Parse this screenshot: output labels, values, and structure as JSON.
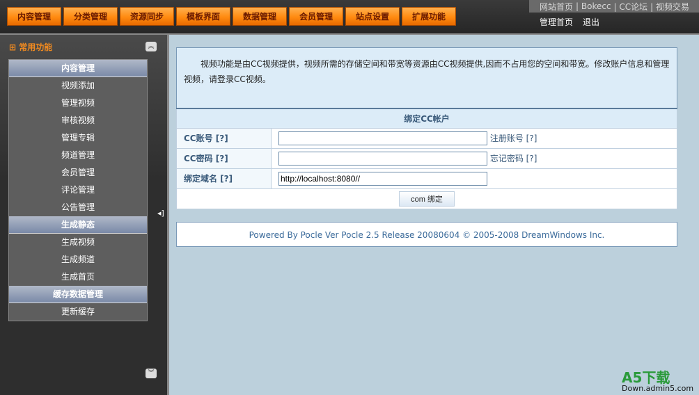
{
  "top_tabs": [
    "内容管理",
    "分类管理",
    "资源同步",
    "模板界面",
    "数据管理",
    "会员管理",
    "站点设置",
    "扩展功能"
  ],
  "top_links": [
    "网站首页",
    "| Bokecc",
    "| CC论坛",
    "| 视频交易"
  ],
  "user_links": [
    "管理首页",
    "退出"
  ],
  "sidebar": {
    "title": "常用功能",
    "groups": [
      {
        "title": "内容管理",
        "items": [
          "视频添加",
          "管理视频",
          "审核视频",
          "管理专辑",
          "频道管理",
          "会员管理",
          "评论管理",
          "公告管理"
        ]
      },
      {
        "title": "生成静态",
        "items": [
          "生成视频",
          "生成频道",
          "生成首页"
        ]
      },
      {
        "title": "缓存数据管理",
        "items": [
          "更新缓存"
        ]
      }
    ]
  },
  "info_text": "视频功能是由CC视频提供，视频所需的存储空间和带宽等资源由CC视频提供,因而不占用您的空间和带宽。修改账户信息和管理视频，请登录CC视频。",
  "form": {
    "title": "绑定CC帐户",
    "account_label": "CC账号 [?]",
    "account_value": "",
    "account_hint": "注册账号 [?]",
    "password_label": "CC密码 [?]",
    "password_value": "",
    "password_hint": "忘记密码 [?]",
    "domain_label": "绑定域名 [?]",
    "domain_value": "http://localhost:8080//",
    "submit_label": "com 绑定"
  },
  "footer": "Powered By Pocle Ver Pocle 2.5 Release 20080604 © 2005-2008 DreamWindows Inc.",
  "watermark": {
    "logo": "A5下载",
    "url": "Down.admin5.com"
  }
}
